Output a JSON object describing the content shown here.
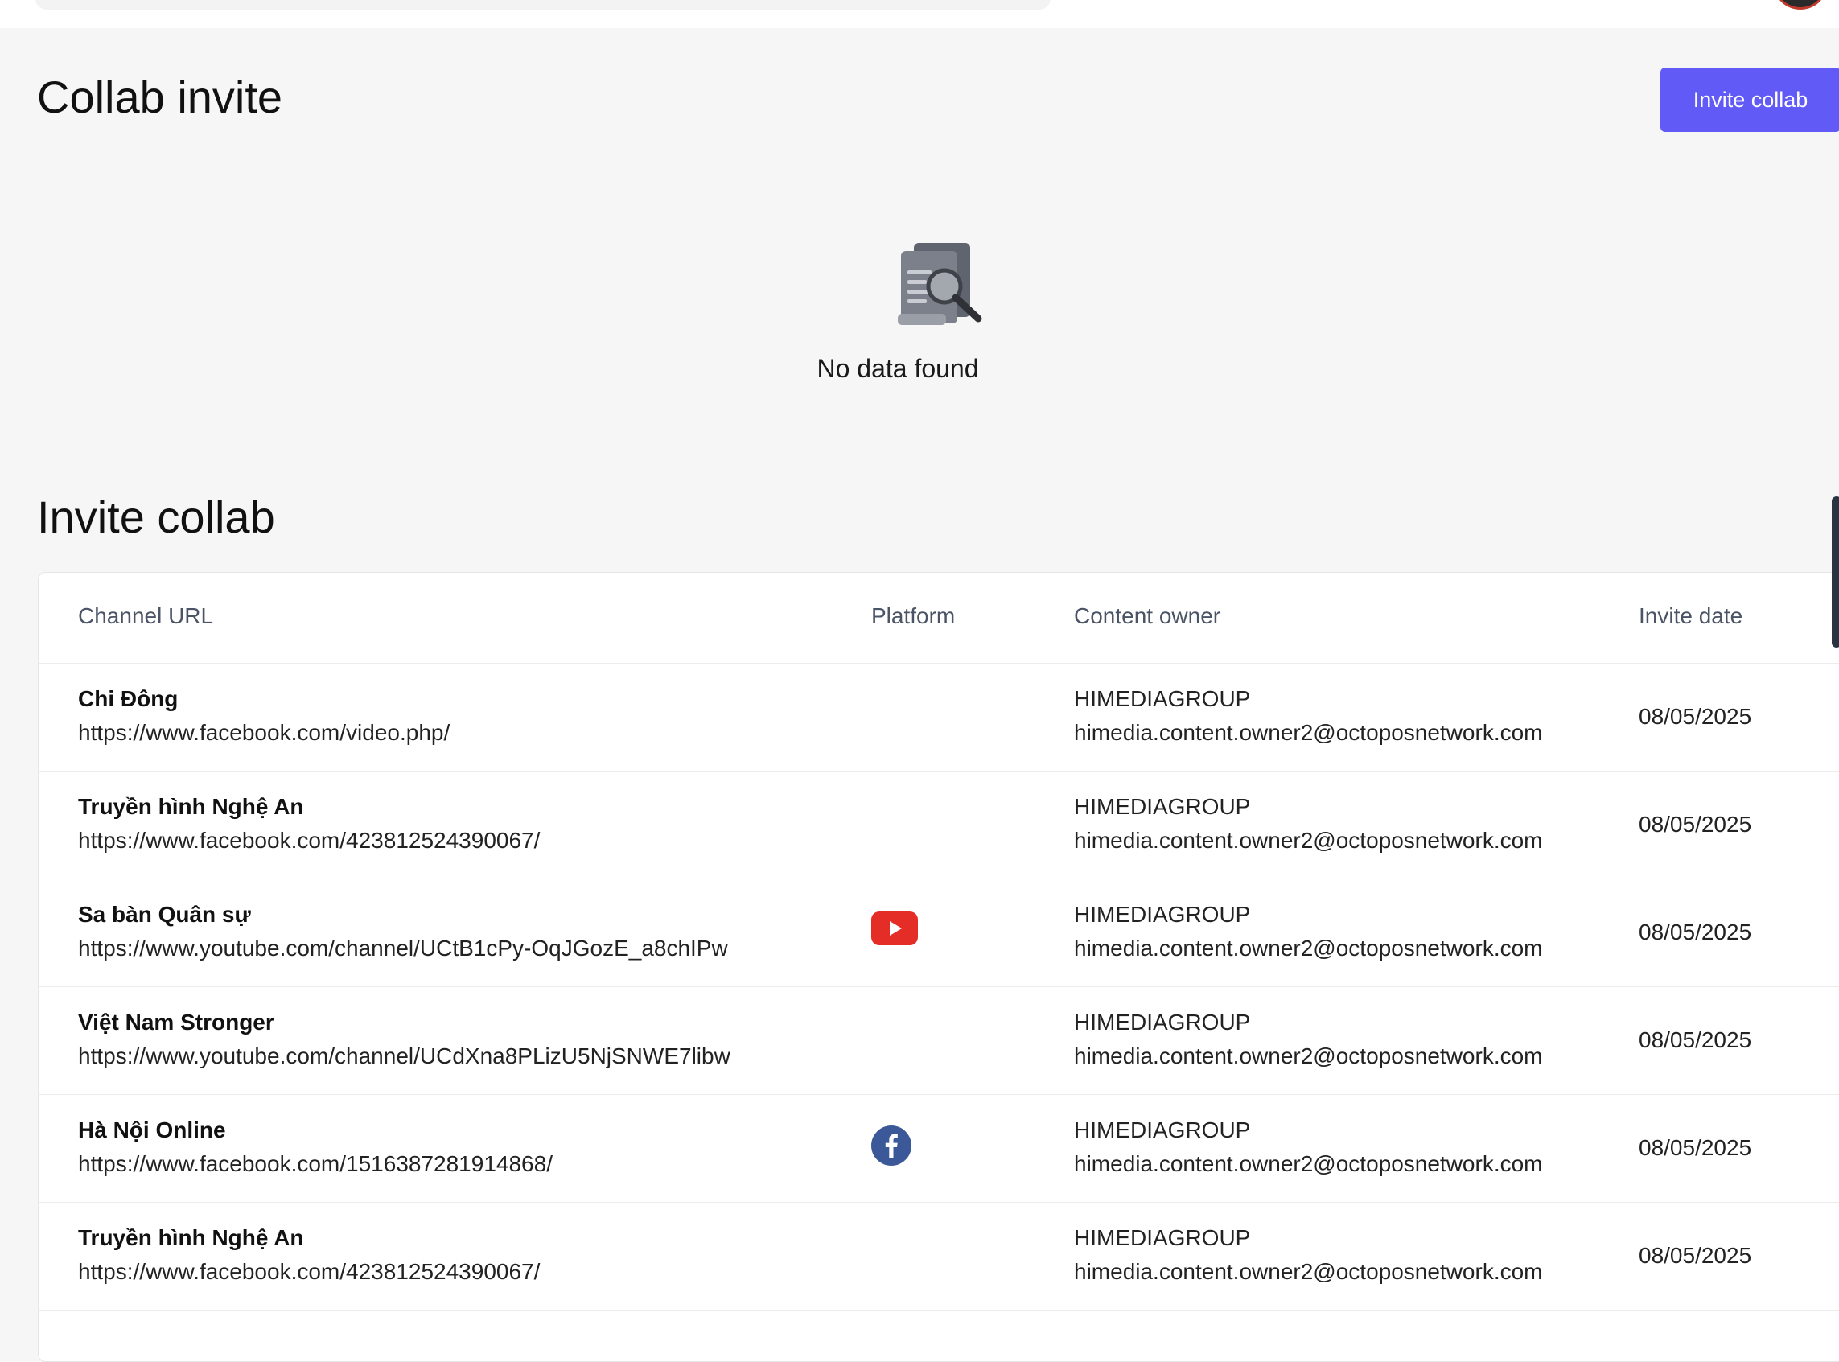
{
  "page": {
    "title": "Collab invite",
    "invite_button": "Invite collab",
    "empty_state": "No data found",
    "section_title": "Invite collab"
  },
  "table": {
    "headers": {
      "channel_url": "Channel URL",
      "platform": "Platform",
      "content_owner": "Content owner",
      "invite_date": "Invite date"
    },
    "rows": [
      {
        "name": "Chi Đông",
        "url": "https://www.facebook.com/video.php/",
        "platform": "",
        "owner": "HIMEDIAGROUP",
        "email": "himedia.content.owner2@octoposnetwork.com",
        "date": "08/05/2025"
      },
      {
        "name": "Truyền hình Nghệ An",
        "url": "https://www.facebook.com/423812524390067/",
        "platform": "",
        "owner": "HIMEDIAGROUP",
        "email": "himedia.content.owner2@octoposnetwork.com",
        "date": "08/05/2025"
      },
      {
        "name": "Sa bàn Quân sự",
        "url": "https://www.youtube.com/channel/UCtB1cPy-OqJGozE_a8chIPw",
        "platform": "youtube-icon",
        "owner": "HIMEDIAGROUP",
        "email": "himedia.content.owner2@octoposnetwork.com",
        "date": "08/05/2025"
      },
      {
        "name": "Việt Nam Stronger",
        "url": "https://www.youtube.com/channel/UCdXna8PLizU5NjSNWE7libw",
        "platform": "",
        "owner": "HIMEDIAGROUP",
        "email": "himedia.content.owner2@octoposnetwork.com",
        "date": "08/05/2025"
      },
      {
        "name": "Hà Nội Online",
        "url": "https://www.facebook.com/1516387281914868/",
        "platform": "facebook-icon",
        "owner": "HIMEDIAGROUP",
        "email": "himedia.content.owner2@octoposnetwork.com",
        "date": "08/05/2025"
      },
      {
        "name": "Truyền hình Nghệ An",
        "url": "https://www.facebook.com/423812524390067/",
        "platform": "",
        "owner": "HIMEDIAGROUP",
        "email": "himedia.content.owner2@octoposnetwork.com",
        "date": "08/05/2025"
      }
    ]
  },
  "colors": {
    "accent": "#625af6",
    "youtube": "#e52d27",
    "facebook": "#3b5998"
  }
}
